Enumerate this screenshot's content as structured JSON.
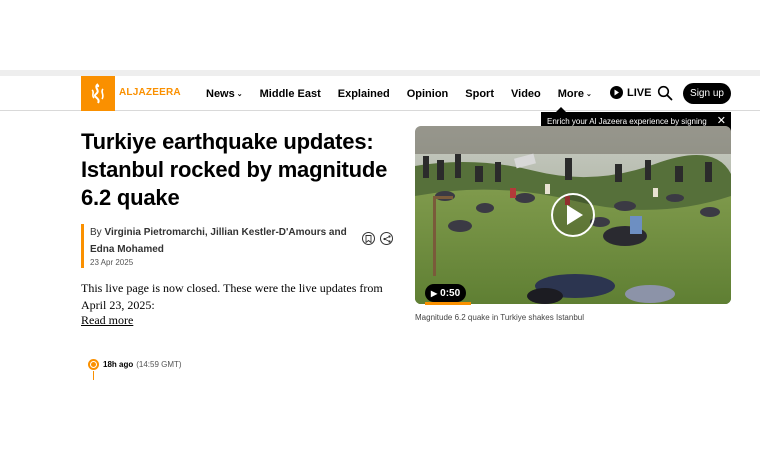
{
  "brand": {
    "name": "ALJAZEERA",
    "color": "#fa9000"
  },
  "nav": {
    "items": [
      {
        "label": "News",
        "dropdown": true
      },
      {
        "label": "Middle East",
        "dropdown": false
      },
      {
        "label": "Explained",
        "dropdown": false
      },
      {
        "label": "Opinion",
        "dropdown": false
      },
      {
        "label": "Sport",
        "dropdown": false
      },
      {
        "label": "Video",
        "dropdown": false
      },
      {
        "label": "More",
        "dropdown": true
      }
    ],
    "live_label": "LIVE",
    "signup_label": "Sign up"
  },
  "tooltip": {
    "text": "Enrich your Al Jazeera experience by signing in or creating an account."
  },
  "article": {
    "headline": "Turkiye earthquake updates: Istanbul rocked by magnitude 6.2 quake",
    "by_prefix": "By",
    "authors": "Virginia Pietromarchi, Jillian Kestler-D'Amours and Edna Mohamed",
    "date": "23 Apr 2025",
    "summary": "This live page is now closed. These were the live updates from April 23, 2025:",
    "read_more": "Read more"
  },
  "video": {
    "duration": "0:50",
    "caption": "Magnitude 6.2 quake in Turkiye shakes Istanbul"
  },
  "timeline": {
    "ago": "18h ago",
    "time": "(14:59 GMT)"
  }
}
